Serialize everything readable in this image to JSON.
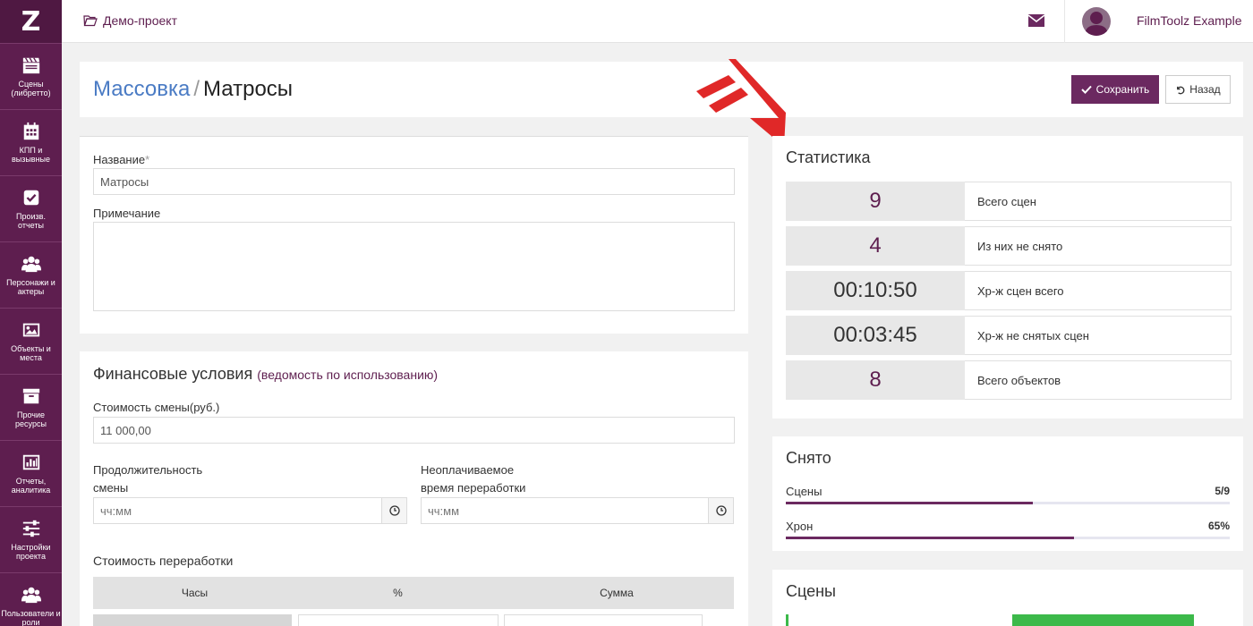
{
  "sidebar": {
    "logo": "Z",
    "items": [
      {
        "label": "Сцены\n(либретто)",
        "icon": "clapperboard-icon"
      },
      {
        "label": "КПП и\nвызывные",
        "icon": "calendar-icon"
      },
      {
        "label": "Произв.\nотчеты",
        "icon": "checkbox-icon"
      },
      {
        "label": "Персонажи и\nактеры",
        "icon": "users-icon"
      },
      {
        "label": "Объекты и\nместа",
        "icon": "image-icon"
      },
      {
        "label": "Прочие\nресурсы",
        "icon": "archive-icon"
      },
      {
        "label": "Отчеты,\nаналитика",
        "icon": "bar-chart-icon"
      },
      {
        "label": "Настройки\nпроекта",
        "icon": "sliders-icon"
      },
      {
        "label": "Пользователи и\nроли",
        "icon": "users-icon"
      }
    ]
  },
  "topbar": {
    "project": "Демо-проект",
    "user": "FilmToolz Example"
  },
  "header": {
    "breadcrumb_link": "Массовка",
    "separator": "/",
    "current": "Матросы",
    "save_label": "Сохранить",
    "back_label": "Назад"
  },
  "form": {
    "name_label": "Название",
    "name_required": "*",
    "name_value": "Матросы",
    "note_label": "Примечание",
    "note_value": ""
  },
  "finance": {
    "title": "Финансовые условия",
    "subtitle": "(ведомость по использованию)",
    "shift_cost_label": "Стоимость смены(руб.)",
    "shift_cost_value": "11 000,00",
    "duration_label_1": "Продолжительность",
    "duration_label_2": "смены",
    "duration_placeholder": "чч:мм",
    "unpaid_label_1": "Неоплачиваемое",
    "unpaid_label_2": "время переработки",
    "unpaid_placeholder": "чч:мм",
    "overtime_label": "Стоимость переработки",
    "overtime_columns": [
      "Часы",
      "%",
      "Сумма"
    ]
  },
  "stats": {
    "title": "Статистика",
    "rows": [
      {
        "value": "9",
        "label": "Всего сцен"
      },
      {
        "value": "4",
        "label": "Из них не снято"
      },
      {
        "value": "00:10:50",
        "label": "Хр-ж сцен всего"
      },
      {
        "value": "00:03:45",
        "label": "Хр-ж не снятых сцен"
      },
      {
        "value": "8",
        "label": "Всего объектов"
      }
    ]
  },
  "shot": {
    "title": "Снято",
    "scenes_label": "Сцены",
    "scenes_value": "5/9",
    "scenes_fraction": 0.556,
    "chron_label": "Хрон",
    "chron_value": "65%",
    "chron_fraction": 0.65
  },
  "scenes": {
    "title": "Сцены"
  }
}
